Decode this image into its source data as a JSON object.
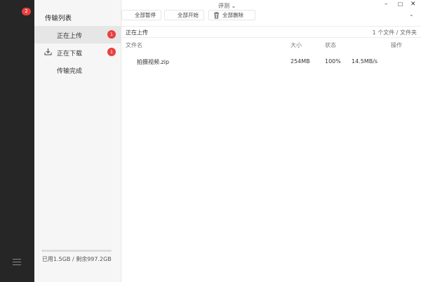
{
  "rail": {
    "badge": "2"
  },
  "sidebar": {
    "title": "传输列表",
    "items": [
      {
        "label": "正在上传",
        "badge": "1"
      },
      {
        "label": "正在下载",
        "badge": "1"
      },
      {
        "label": "传输完成"
      }
    ],
    "storage": {
      "text": "已用1.5GB / 剩余997.2GB",
      "used_fraction": 0.0015
    }
  },
  "window": {
    "title": "评测 ⌄",
    "minimize": "–",
    "maximize": "☐",
    "close": "✕"
  },
  "toolbar": {
    "pause_all": "全部暂停",
    "start_all": "全部开始",
    "delete_all": "全部删除",
    "collapse": "⌄"
  },
  "section": {
    "title": "正在上传",
    "count": "1 个文件 / 文件夹"
  },
  "table": {
    "headers": {
      "name": "文件名",
      "size": "大小",
      "status": "状态",
      "actions": "操作"
    },
    "rows": [
      {
        "name": "拍摄视频.zip",
        "size": "254MB",
        "status": "100%",
        "speed": "14.5MB/s"
      }
    ]
  }
}
